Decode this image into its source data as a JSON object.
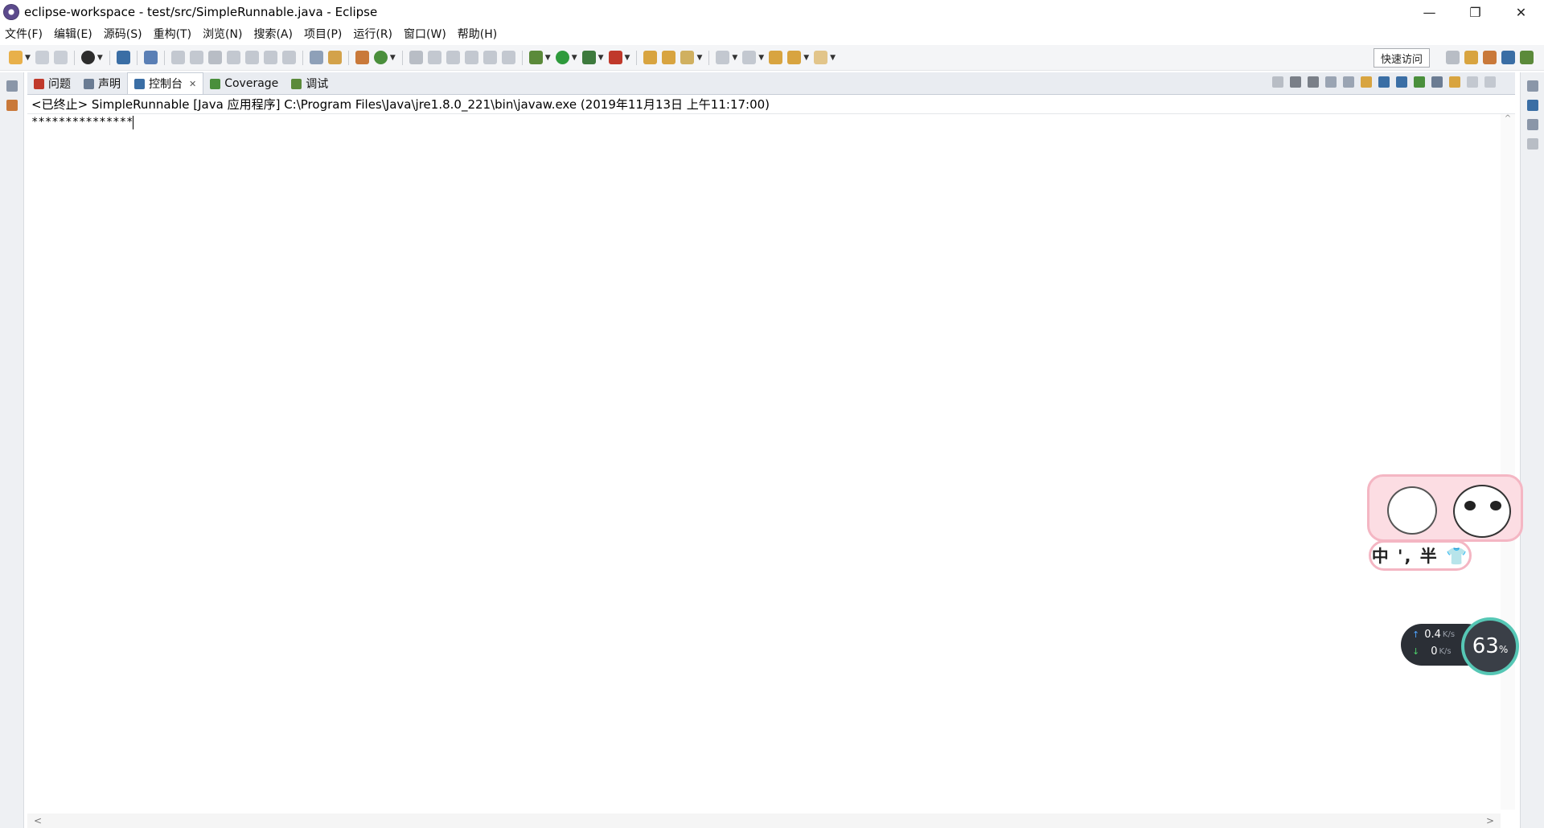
{
  "window": {
    "title": "eclipse-workspace - test/src/SimpleRunnable.java - Eclipse",
    "controls": {
      "minimize": "—",
      "restore": "❐",
      "close": "✕"
    }
  },
  "menu": [
    "文件(F)",
    "编辑(E)",
    "源码(S)",
    "重构(T)",
    "浏览(N)",
    "搜索(A)",
    "项目(P)",
    "运行(R)",
    "窗口(W)",
    "帮助(H)"
  ],
  "toolbar": {
    "quick_access": "快速访问"
  },
  "tabs": [
    {
      "label": "问题",
      "icon": "problems-icon",
      "color": "#c0392b"
    },
    {
      "label": "声明",
      "icon": "declaration-icon",
      "color": "#6b7c93"
    },
    {
      "label": "控制台",
      "icon": "console-icon",
      "color": "#3a6ea5",
      "close": "✕",
      "active": true
    },
    {
      "label": "Coverage",
      "icon": "coverage-icon",
      "color": "#4a8f3c"
    },
    {
      "label": "调试",
      "icon": "debug-icon",
      "color": "#5b8a3a"
    }
  ],
  "console": {
    "header": "<已终止> SimpleRunnable [Java 应用程序] C:\\Program Files\\Java\\jre1.8.0_221\\bin\\javaw.exe  (2019年11月13日 上午11:17:00)",
    "output": "***************"
  },
  "scroll": {
    "up": "^",
    "down": "v",
    "left": "<",
    "right": ">"
  },
  "ime": {
    "label": "中 ', 半 👕"
  },
  "network": {
    "upload": "0.4",
    "download": "0",
    "unit": "K/s",
    "up_arrow": "↑",
    "down_arrow": "↓",
    "percent": "63",
    "percent_sign": "%"
  },
  "colors": {
    "accent": "#3a6ea5",
    "gauge": "#56c7b5",
    "ime_pink": "#fcdde3"
  }
}
